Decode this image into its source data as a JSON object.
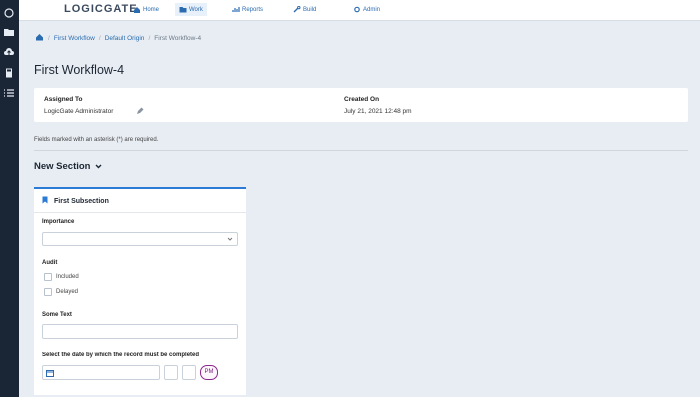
{
  "app": {
    "logo_text": "LOGICGATE",
    "brand_color": "#2b6cb0",
    "nav": [
      {
        "label": "Home",
        "icon": "home-icon",
        "active": false
      },
      {
        "label": "Work",
        "icon": "folder-icon",
        "active": true
      },
      {
        "label": "Reports",
        "icon": "chart-icon",
        "active": false
      },
      {
        "label": "Build",
        "icon": "wrench-icon",
        "active": false
      },
      {
        "label": "Admin",
        "icon": "gear-icon",
        "active": false
      }
    ]
  },
  "sidebar_rail": {
    "icons": [
      "folder-icon",
      "cloud-upload-icon",
      "calculator-icon",
      "list-icon"
    ]
  },
  "breadcrumb": {
    "items": [
      "First Workflow",
      "Default Origin",
      "First Workflow-4"
    ]
  },
  "page": {
    "title": "First Workflow-4"
  },
  "assignment": {
    "assigned_to_label": "Assigned To",
    "assigned_to_value": "LogicGate Administrator",
    "created_on_label": "Created On",
    "created_on_value": "July 21, 2021 12:48 pm"
  },
  "required_note": "Fields marked with an asterisk (*) are required.",
  "section": {
    "title": "New Section",
    "subsection": {
      "title": "First Subsection",
      "importance_label": "Importance",
      "importance_value": "",
      "audit_label": "Audit",
      "audit_options": [
        "Included",
        "Delayed"
      ],
      "some_text_label": "Some Text",
      "some_text_value": "",
      "date_label": "Select the date by which the record must be completed",
      "date_value": "",
      "ampm_value": "PM"
    }
  }
}
